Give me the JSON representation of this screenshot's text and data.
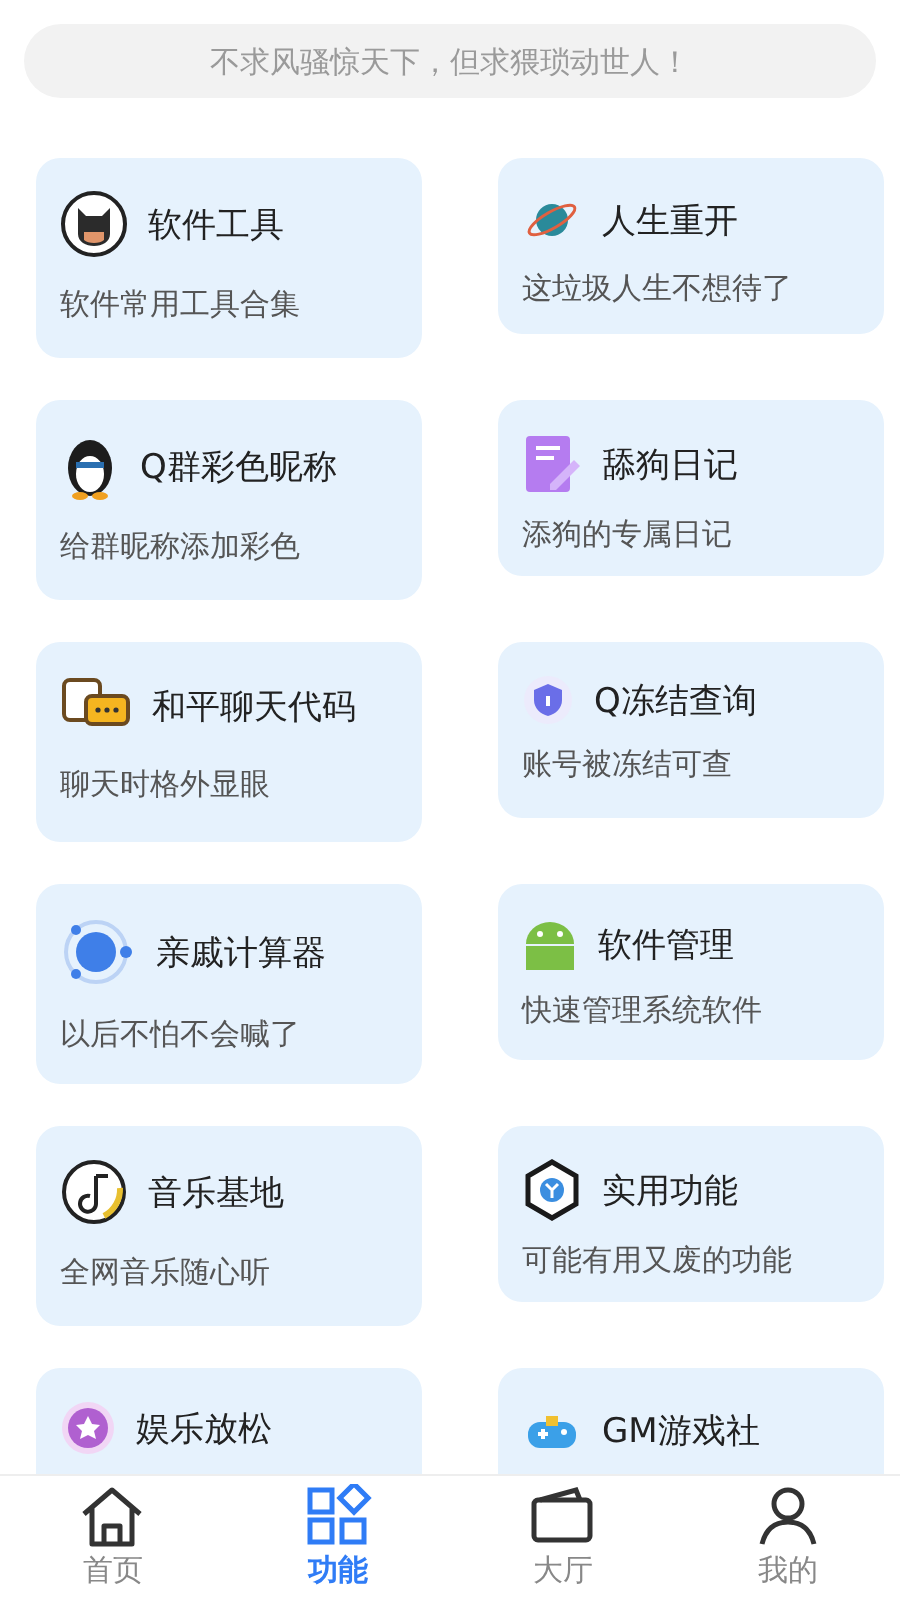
{
  "search": {
    "placeholder": "不求风骚惊天下，但求猥琐动世人！"
  },
  "cards": [
    {
      "title": "软件工具",
      "subtitle": "软件常用工具合集"
    },
    {
      "title": "人生重开",
      "subtitle": "这垃圾人生不想待了"
    },
    {
      "title": "Q群彩色昵称",
      "subtitle": "给群昵称添加彩色"
    },
    {
      "title": "舔狗日记",
      "subtitle": "添狗的专属日记"
    },
    {
      "title": "和平聊天代码",
      "subtitle": "聊天时格外显眼"
    },
    {
      "title": "Q冻结查询",
      "subtitle": "账号被冻结可查"
    },
    {
      "title": "亲戚计算器",
      "subtitle": "以后不怕不会喊了"
    },
    {
      "title": "软件管理",
      "subtitle": "快速管理系统软件"
    },
    {
      "title": "音乐基地",
      "subtitle": "全网音乐随心听"
    },
    {
      "title": "实用功能",
      "subtitle": "可能有用又废的功能"
    },
    {
      "title": "娱乐放松"
    },
    {
      "title": "GM游戏社"
    }
  ],
  "nav": [
    {
      "label": "首页",
      "selected": false
    },
    {
      "label": "功能",
      "selected": true
    },
    {
      "label": "大厅",
      "selected": false
    },
    {
      "label": "我的",
      "selected": false
    }
  ]
}
